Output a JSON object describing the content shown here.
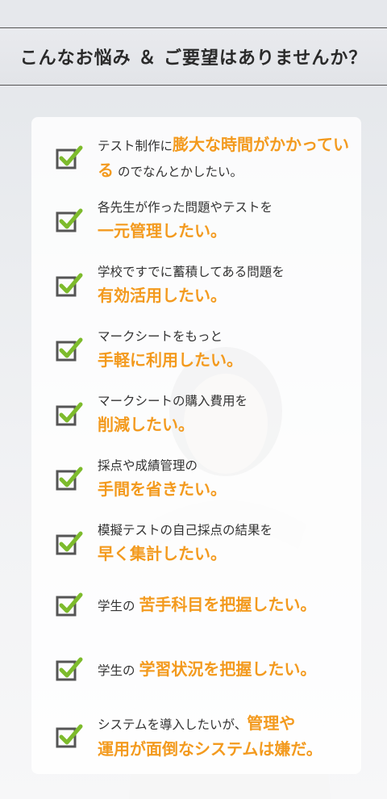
{
  "title": "こんなお悩み ＆ ご要望はありませんか？",
  "items": [
    {
      "pre": "テスト制作に",
      "hl1": "膨大な時間がかかっている",
      "post": "のでなんとかしたい。",
      "line2": ""
    },
    {
      "pre": "各先生が作った問題やテストを",
      "hl1": "",
      "post": "",
      "line2": "一元管理したい。"
    },
    {
      "pre": "学校ですでに蓄積してある問題を",
      "hl1": "",
      "post": "",
      "line2": "有効活用したい。"
    },
    {
      "pre": "マークシートをもっと",
      "hl1": "",
      "post": "",
      "line2": "手軽に利用したい。"
    },
    {
      "pre": "マークシートの購入費用を",
      "hl1": "",
      "post": "",
      "line2": "削減したい。"
    },
    {
      "pre": "採点や成績管理の",
      "hl1": "",
      "post": "",
      "line2": "手間を省きたい。"
    },
    {
      "pre": "模擬テストの自己採点の結果を",
      "hl1": "",
      "post": "",
      "line2": "早く集計したい。"
    },
    {
      "pre": "学生の ",
      "hl1": "苦手科目を把握したい。",
      "post": "",
      "line2": ""
    },
    {
      "pre": "学生の ",
      "hl1": "学習状況を把握したい。",
      "post": "",
      "line2": ""
    },
    {
      "pre": "システムを導入したいが、",
      "hl1": "管理や",
      "post": "",
      "line2": "運用が面倒なシステムは嫌だ。"
    }
  ],
  "colors": {
    "accent": "#f39a1e",
    "check": "#7dbb2c",
    "box": "#555555"
  },
  "icons": {
    "check": "checkbox-check-icon"
  }
}
